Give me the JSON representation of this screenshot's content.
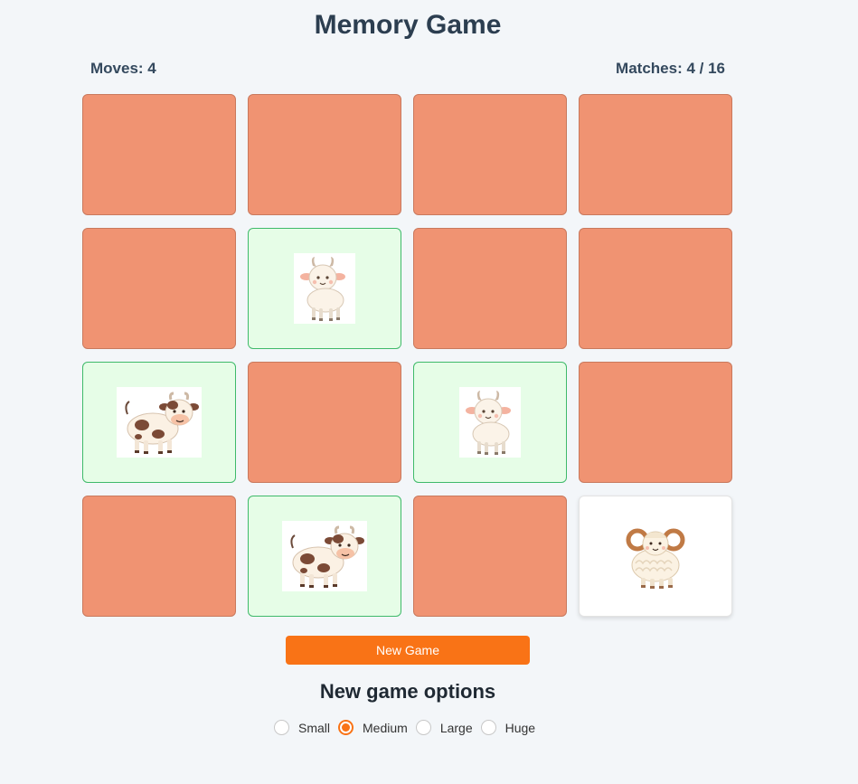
{
  "header": {
    "title": "Memory Game"
  },
  "stats": {
    "moves_label": "Moves: 4",
    "matches_label": "Matches: 4 / 16"
  },
  "board": {
    "rows": 4,
    "columns": 4,
    "cards": [
      {
        "state": "hidden",
        "icon": ""
      },
      {
        "state": "hidden",
        "icon": ""
      },
      {
        "state": "hidden",
        "icon": ""
      },
      {
        "state": "hidden",
        "icon": ""
      },
      {
        "state": "hidden",
        "icon": ""
      },
      {
        "state": "matched",
        "icon": "goat-icon"
      },
      {
        "state": "hidden",
        "icon": ""
      },
      {
        "state": "hidden",
        "icon": ""
      },
      {
        "state": "matched",
        "icon": "cow-icon"
      },
      {
        "state": "hidden",
        "icon": ""
      },
      {
        "state": "matched",
        "icon": "goat-icon"
      },
      {
        "state": "hidden",
        "icon": ""
      },
      {
        "state": "hidden",
        "icon": ""
      },
      {
        "state": "matched",
        "icon": "cow-icon"
      },
      {
        "state": "hidden",
        "icon": ""
      },
      {
        "state": "revealed",
        "icon": "ram-icon"
      }
    ]
  },
  "actions": {
    "new_game_label": "New Game"
  },
  "options": {
    "heading": "New game options",
    "sizes": [
      {
        "label": "Small",
        "selected": false
      },
      {
        "label": "Medium",
        "selected": true
      },
      {
        "label": "Large",
        "selected": false
      },
      {
        "label": "Huge",
        "selected": false
      }
    ]
  },
  "colors": {
    "card_back": "#f09372",
    "matched_background": "#e6fde7",
    "matched_border": "#3fba6a",
    "accent": "#f97316",
    "page_background": "#f3f6f9"
  }
}
